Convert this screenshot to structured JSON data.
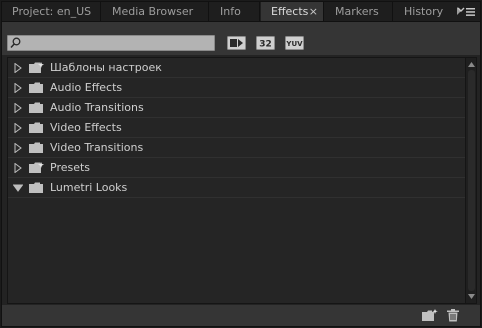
{
  "tabs": [
    {
      "label": "Project: en_US",
      "active": false
    },
    {
      "label": "Media Browser",
      "active": false
    },
    {
      "label": "Info",
      "active": false
    },
    {
      "label": "Effects",
      "active": true
    },
    {
      "label": "Markers",
      "active": false
    },
    {
      "label": "History",
      "active": false
    }
  ],
  "tab_close_glyph": "×",
  "search": {
    "value": "",
    "placeholder": ""
  },
  "filters": [
    {
      "icon": "accelerated-effects-icon"
    },
    {
      "icon": "32-bit-color-icon",
      "text": "32"
    },
    {
      "icon": "yuv-effects-icon",
      "text": "YUV"
    }
  ],
  "tree": [
    {
      "label": "Шаблоны настроек",
      "expanded": false,
      "icon": "preset-bin-icon"
    },
    {
      "label": "Audio Effects",
      "expanded": false,
      "icon": "folder-icon"
    },
    {
      "label": "Audio Transitions",
      "expanded": false,
      "icon": "folder-icon"
    },
    {
      "label": "Video Effects",
      "expanded": false,
      "icon": "folder-icon"
    },
    {
      "label": "Video Transitions",
      "expanded": false,
      "icon": "folder-icon"
    },
    {
      "label": "Presets",
      "expanded": false,
      "icon": "preset-bin-icon"
    },
    {
      "label": "Lumetri Looks",
      "expanded": true,
      "icon": "folder-icon"
    }
  ],
  "colors": {
    "panel_bg": "#353535",
    "tree_bg": "#252525",
    "active_tab_bg": "#353535",
    "text": "#cfcfcf"
  }
}
